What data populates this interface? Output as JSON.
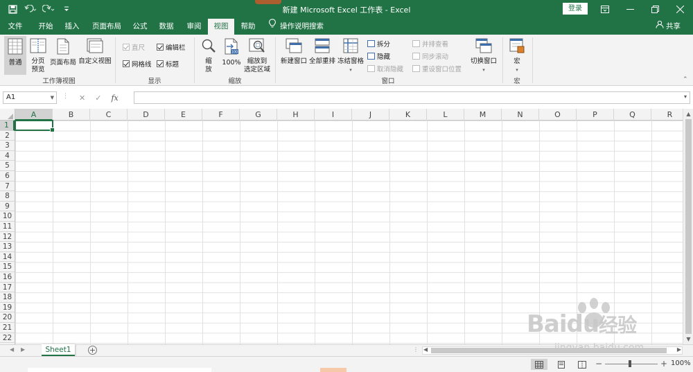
{
  "window": {
    "title": "新建 Microsoft Excel 工作表  -  Excel",
    "login_label": "登录"
  },
  "tabs": [
    {
      "label": "文件"
    },
    {
      "label": "开始"
    },
    {
      "label": "插入"
    },
    {
      "label": "页面布局"
    },
    {
      "label": "公式"
    },
    {
      "label": "数据"
    },
    {
      "label": "审阅"
    },
    {
      "label": "视图",
      "active": true
    },
    {
      "label": "帮助"
    }
  ],
  "tell_me": "操作说明搜索",
  "share_label": "共享",
  "ribbon": {
    "workbook_views": {
      "group_label": "工作簿视图",
      "normal": "普通",
      "page_break_1": "分页",
      "page_break_2": "预览",
      "page_layout": "页面布局",
      "custom_views": "自定义视图"
    },
    "show": {
      "group_label": "显示",
      "ruler": "直尺",
      "formula_bar": "编辑栏",
      "gridlines": "网格线",
      "headings": "标题"
    },
    "zoom": {
      "group_label": "缩放",
      "zoom_1": "缩",
      "zoom_2": "放",
      "hundred": "100%",
      "zoom_sel_1": "缩放到",
      "zoom_sel_2": "选定区域"
    },
    "window": {
      "group_label": "窗口",
      "new_window": "新建窗口",
      "arrange_all": "全部重排",
      "freeze_panes": "冻结窗格",
      "split": "拆分",
      "hide": "隐藏",
      "unhide": "取消隐藏",
      "side_by_side": "并排查看",
      "sync_scroll": "同步滚动",
      "reset_position": "重设窗口位置",
      "switch_windows": "切换窗口"
    },
    "macros": {
      "group_label": "宏",
      "macros": "宏"
    }
  },
  "formula_bar": {
    "name_box": "A1",
    "fx": "fx",
    "value": ""
  },
  "columns": [
    "A",
    "B",
    "C",
    "D",
    "E",
    "F",
    "G",
    "H",
    "I",
    "J",
    "K",
    "L",
    "M",
    "N",
    "O",
    "P",
    "Q",
    "R"
  ],
  "rows": [
    "1",
    "2",
    "3",
    "4",
    "5",
    "6",
    "7",
    "8",
    "9",
    "10",
    "11",
    "12",
    "13",
    "14",
    "15",
    "16",
    "17",
    "18",
    "19",
    "20",
    "21",
    "22"
  ],
  "active_cell": "A1",
  "sheets": [
    {
      "name": "Sheet1",
      "active": true
    }
  ],
  "status": {
    "zoom": "100%"
  },
  "watermark": {
    "brand": "Baidu",
    "cn": "经验",
    "url": "jingyan.baidu.com"
  },
  "colors": {
    "excel_green": "#217346",
    "ribbon_bg": "#f3f3f3"
  }
}
